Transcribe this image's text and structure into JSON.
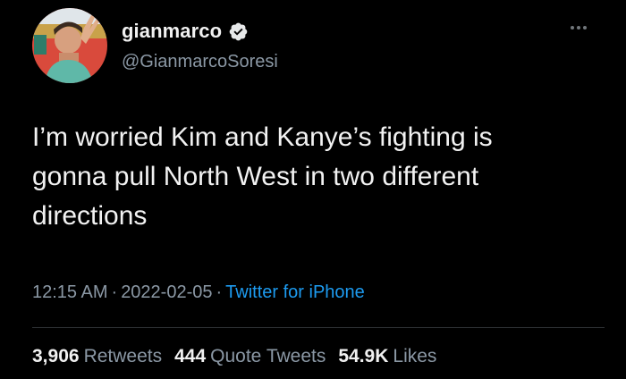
{
  "user": {
    "display_name": "gianmarco",
    "handle": "@GianmarcoSoresi",
    "verified": true
  },
  "icons": {
    "verified": "verified-badge-icon",
    "more": "more-options-icon"
  },
  "tweet": {
    "text": "I’m worried Kim and Kanye’s fighting is\ngonna pull North West in two different\ndirections"
  },
  "meta": {
    "time": "12:15 AM",
    "separator": "·",
    "date": "2022-02-05",
    "source": "Twitter for iPhone"
  },
  "stats": [
    {
      "count": "3,906",
      "label": "Retweets"
    },
    {
      "count": "444",
      "label": "Quote Tweets"
    },
    {
      "count": "54.9K",
      "label": "Likes"
    }
  ],
  "colors": {
    "background": "#000000",
    "text": "#e7e9ea",
    "secondary": "#8b98a5",
    "link": "#1d9bf0",
    "verified": "#e7e9ea"
  }
}
